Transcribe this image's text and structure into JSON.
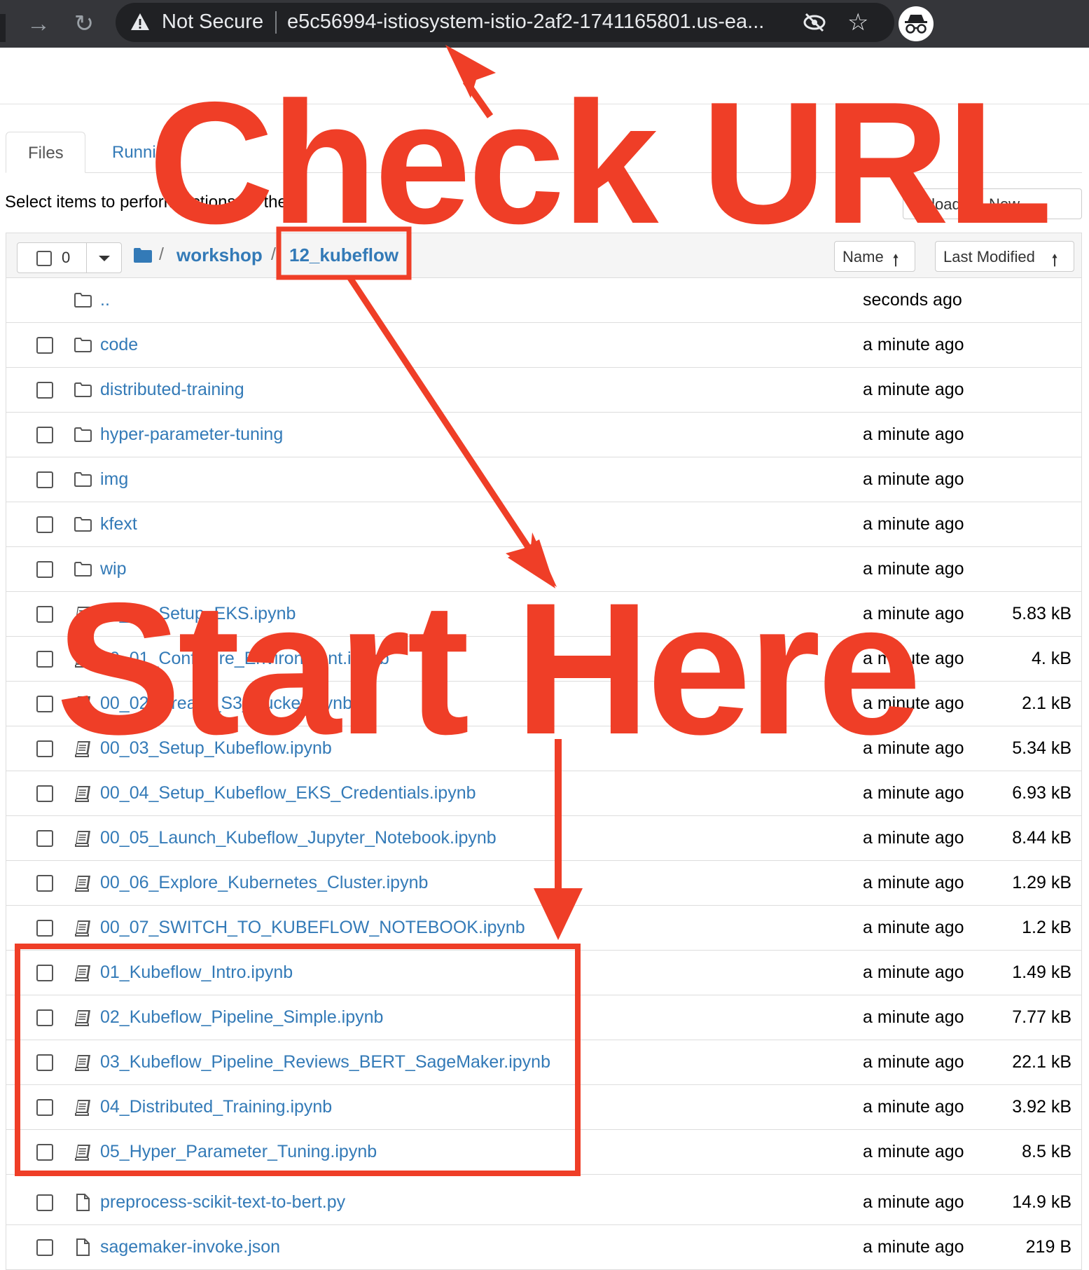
{
  "browser": {
    "security_label": "Not Secure",
    "url": "e5c56994-istiosystem-istio-2af2-1741165801.us-ea...",
    "icons": [
      "back-arrow-icon",
      "forward-arrow-icon",
      "reload-icon",
      "warning-icon",
      "eye-off-icon",
      "star-icon",
      "incognito-icon"
    ]
  },
  "tabs": [
    {
      "label": "Files",
      "active": true
    },
    {
      "label": "Running",
      "active": false
    }
  ],
  "toolbar": {
    "select_hint": "Select items to perform actions on them.",
    "upload_label": "Upload",
    "new_label": "New"
  },
  "listing": {
    "selected_count": "0",
    "breadcrumb": [
      "workshop",
      "12_kubeflow"
    ],
    "breadcrumb_sep": "/",
    "sort_name_label": "Name",
    "sort_modified_label": "Last Modified",
    "rows": [
      {
        "type": "parent",
        "name": "..",
        "modified": "seconds ago",
        "size": ""
      },
      {
        "type": "folder",
        "name": "code",
        "modified": "a minute ago",
        "size": ""
      },
      {
        "type": "folder",
        "name": "distributed-training",
        "modified": "a minute ago",
        "size": ""
      },
      {
        "type": "folder",
        "name": "hyper-parameter-tuning",
        "modified": "a minute ago",
        "size": ""
      },
      {
        "type": "folder",
        "name": "img",
        "modified": "a minute ago",
        "size": ""
      },
      {
        "type": "folder",
        "name": "kfext",
        "modified": "a minute ago",
        "size": ""
      },
      {
        "type": "folder",
        "name": "wip",
        "modified": "a minute ago",
        "size": ""
      },
      {
        "type": "notebook",
        "name": "00_00_Setup_EKS.ipynb",
        "modified": "a minute ago",
        "size": "5.83 kB"
      },
      {
        "type": "notebook",
        "name": "00_01_Configure_Environment.ipynb",
        "modified": "a minute ago",
        "size": "4.  kB"
      },
      {
        "type": "notebook",
        "name": "00_02_Create_S3_Bucket.ipynb",
        "modified": "a minute ago",
        "size": "2.1 kB"
      },
      {
        "type": "notebook",
        "name": "00_03_Setup_Kubeflow.ipynb",
        "modified": "a minute ago",
        "size": "5.34 kB"
      },
      {
        "type": "notebook",
        "name": "00_04_Setup_Kubeflow_EKS_Credentials.ipynb",
        "modified": "a minute ago",
        "size": "6.93 kB"
      },
      {
        "type": "notebook",
        "name": "00_05_Launch_Kubeflow_Jupyter_Notebook.ipynb",
        "modified": "a minute ago",
        "size": "8.44 kB"
      },
      {
        "type": "notebook",
        "name": "00_06_Explore_Kubernetes_Cluster.ipynb",
        "modified": "a minute ago",
        "size": "1.29 kB"
      },
      {
        "type": "notebook",
        "name": "00_07_SWITCH_TO_KUBEFLOW_NOTEBOOK.ipynb",
        "modified": "a minute ago",
        "size": "1.2 kB"
      },
      {
        "type": "notebook",
        "name": "01_Kubeflow_Intro.ipynb",
        "modified": "a minute ago",
        "size": "1.49 kB"
      },
      {
        "type": "notebook",
        "name": "02_Kubeflow_Pipeline_Simple.ipynb",
        "modified": "a minute ago",
        "size": "7.77 kB"
      },
      {
        "type": "notebook",
        "name": "03_Kubeflow_Pipeline_Reviews_BERT_SageMaker.ipynb",
        "modified": "a minute ago",
        "size": "22.1 kB"
      },
      {
        "type": "notebook",
        "name": "04_Distributed_Training.ipynb",
        "modified": "a minute ago",
        "size": "3.92 kB"
      },
      {
        "type": "notebook",
        "name": "05_Hyper_Parameter_Tuning.ipynb",
        "modified": "a minute ago",
        "size": "8.5 kB"
      },
      {
        "type": "file",
        "name": "preprocess-scikit-text-to-bert.py",
        "modified": "a minute ago",
        "size": "14.9 kB"
      },
      {
        "type": "file",
        "name": "sagemaker-invoke.json",
        "modified": "a minute ago",
        "size": "219 B"
      }
    ]
  },
  "annotations": {
    "check_url": "Check URL",
    "start_here": "Start Here",
    "color": "#ef3e27"
  }
}
